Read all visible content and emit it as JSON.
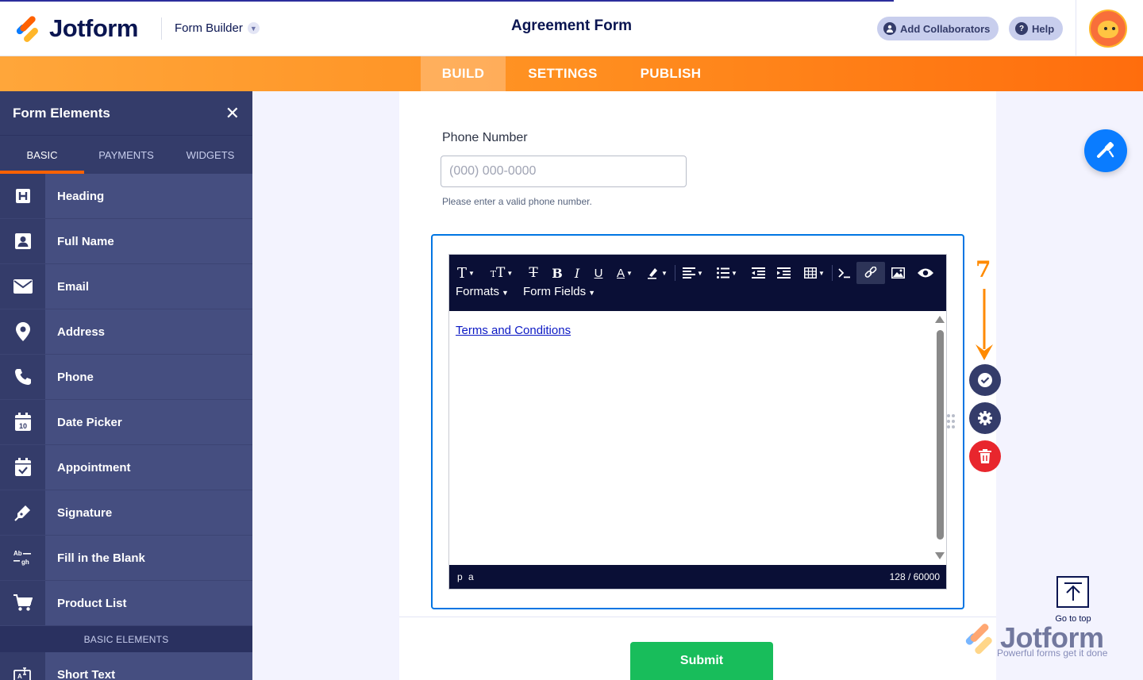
{
  "header": {
    "brand": "Jotform",
    "builder_menu": "Form Builder",
    "form_title": "Agreement Form",
    "add_collaborators": "Add Collaborators",
    "help": "Help",
    "brand_colors": {
      "blue": "#0a7cff",
      "orange": "#ff6100",
      "yellow": "#ffb629",
      "navy": "#0a1551"
    }
  },
  "tabs": [
    {
      "label": "BUILD",
      "active": true
    },
    {
      "label": "SETTINGS",
      "active": false
    },
    {
      "label": "PUBLISH",
      "active": false
    }
  ],
  "sidebar": {
    "title": "Form Elements",
    "tabs": [
      {
        "label": "BASIC",
        "active": true
      },
      {
        "label": "PAYMENTS",
        "active": false
      },
      {
        "label": "WIDGETS",
        "active": false
      }
    ],
    "items": [
      {
        "label": "Heading",
        "icon": "heading-icon"
      },
      {
        "label": "Full Name",
        "icon": "person-icon"
      },
      {
        "label": "Email",
        "icon": "envelope-icon"
      },
      {
        "label": "Address",
        "icon": "location-pin-icon"
      },
      {
        "label": "Phone",
        "icon": "phone-icon"
      },
      {
        "label": "Date Picker",
        "icon": "calendar-icon"
      },
      {
        "label": "Appointment",
        "icon": "calendar-check-icon"
      },
      {
        "label": "Signature",
        "icon": "pen-icon"
      },
      {
        "label": "Fill in the Blank",
        "icon": "fill-blank-icon"
      },
      {
        "label": "Product List",
        "icon": "cart-icon"
      }
    ],
    "section_label": "BASIC ELEMENTS",
    "after_section": [
      {
        "label": "Short Text",
        "icon": "short-text-icon"
      }
    ]
  },
  "form": {
    "phone": {
      "label": "Phone Number",
      "placeholder": "(000) 000-0000",
      "value": "",
      "help": "Please enter a valid phone number."
    },
    "editor": {
      "toolbar_row2": [
        "Formats",
        "Form Fields"
      ],
      "content_link": "Terms and Conditions",
      "status_path": "p a",
      "char_count": "128 / 60000"
    },
    "submit_label": "Submit"
  },
  "annotation": {
    "step_number": "7",
    "color": "#ff8a00"
  },
  "footer": {
    "go_to_top": "Go to top",
    "watermark_brand": "Jotform",
    "watermark_tagline": "Powerful forms get it done"
  }
}
